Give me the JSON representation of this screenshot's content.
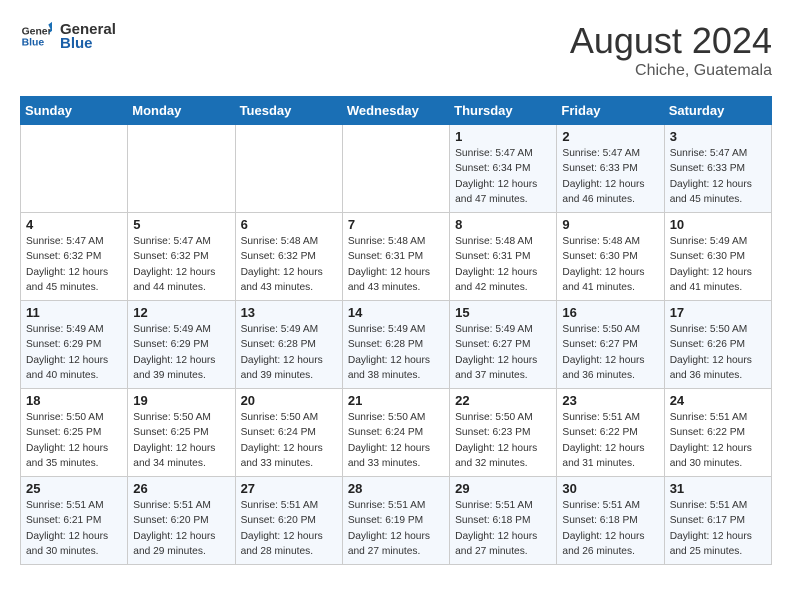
{
  "logo": {
    "line1": "General",
    "line2": "Blue"
  },
  "title": "August 2024",
  "subtitle": "Chiche, Guatemala",
  "weekdays": [
    "Sunday",
    "Monday",
    "Tuesday",
    "Wednesday",
    "Thursday",
    "Friday",
    "Saturday"
  ],
  "weeks": [
    [
      {
        "day": "",
        "info": ""
      },
      {
        "day": "",
        "info": ""
      },
      {
        "day": "",
        "info": ""
      },
      {
        "day": "",
        "info": ""
      },
      {
        "day": "1",
        "info": "Sunrise: 5:47 AM\nSunset: 6:34 PM\nDaylight: 12 hours\nand 47 minutes."
      },
      {
        "day": "2",
        "info": "Sunrise: 5:47 AM\nSunset: 6:33 PM\nDaylight: 12 hours\nand 46 minutes."
      },
      {
        "day": "3",
        "info": "Sunrise: 5:47 AM\nSunset: 6:33 PM\nDaylight: 12 hours\nand 45 minutes."
      }
    ],
    [
      {
        "day": "4",
        "info": "Sunrise: 5:47 AM\nSunset: 6:32 PM\nDaylight: 12 hours\nand 45 minutes."
      },
      {
        "day": "5",
        "info": "Sunrise: 5:47 AM\nSunset: 6:32 PM\nDaylight: 12 hours\nand 44 minutes."
      },
      {
        "day": "6",
        "info": "Sunrise: 5:48 AM\nSunset: 6:32 PM\nDaylight: 12 hours\nand 43 minutes."
      },
      {
        "day": "7",
        "info": "Sunrise: 5:48 AM\nSunset: 6:31 PM\nDaylight: 12 hours\nand 43 minutes."
      },
      {
        "day": "8",
        "info": "Sunrise: 5:48 AM\nSunset: 6:31 PM\nDaylight: 12 hours\nand 42 minutes."
      },
      {
        "day": "9",
        "info": "Sunrise: 5:48 AM\nSunset: 6:30 PM\nDaylight: 12 hours\nand 41 minutes."
      },
      {
        "day": "10",
        "info": "Sunrise: 5:49 AM\nSunset: 6:30 PM\nDaylight: 12 hours\nand 41 minutes."
      }
    ],
    [
      {
        "day": "11",
        "info": "Sunrise: 5:49 AM\nSunset: 6:29 PM\nDaylight: 12 hours\nand 40 minutes."
      },
      {
        "day": "12",
        "info": "Sunrise: 5:49 AM\nSunset: 6:29 PM\nDaylight: 12 hours\nand 39 minutes."
      },
      {
        "day": "13",
        "info": "Sunrise: 5:49 AM\nSunset: 6:28 PM\nDaylight: 12 hours\nand 39 minutes."
      },
      {
        "day": "14",
        "info": "Sunrise: 5:49 AM\nSunset: 6:28 PM\nDaylight: 12 hours\nand 38 minutes."
      },
      {
        "day": "15",
        "info": "Sunrise: 5:49 AM\nSunset: 6:27 PM\nDaylight: 12 hours\nand 37 minutes."
      },
      {
        "day": "16",
        "info": "Sunrise: 5:50 AM\nSunset: 6:27 PM\nDaylight: 12 hours\nand 36 minutes."
      },
      {
        "day": "17",
        "info": "Sunrise: 5:50 AM\nSunset: 6:26 PM\nDaylight: 12 hours\nand 36 minutes."
      }
    ],
    [
      {
        "day": "18",
        "info": "Sunrise: 5:50 AM\nSunset: 6:25 PM\nDaylight: 12 hours\nand 35 minutes."
      },
      {
        "day": "19",
        "info": "Sunrise: 5:50 AM\nSunset: 6:25 PM\nDaylight: 12 hours\nand 34 minutes."
      },
      {
        "day": "20",
        "info": "Sunrise: 5:50 AM\nSunset: 6:24 PM\nDaylight: 12 hours\nand 33 minutes."
      },
      {
        "day": "21",
        "info": "Sunrise: 5:50 AM\nSunset: 6:24 PM\nDaylight: 12 hours\nand 33 minutes."
      },
      {
        "day": "22",
        "info": "Sunrise: 5:50 AM\nSunset: 6:23 PM\nDaylight: 12 hours\nand 32 minutes."
      },
      {
        "day": "23",
        "info": "Sunrise: 5:51 AM\nSunset: 6:22 PM\nDaylight: 12 hours\nand 31 minutes."
      },
      {
        "day": "24",
        "info": "Sunrise: 5:51 AM\nSunset: 6:22 PM\nDaylight: 12 hours\nand 30 minutes."
      }
    ],
    [
      {
        "day": "25",
        "info": "Sunrise: 5:51 AM\nSunset: 6:21 PM\nDaylight: 12 hours\nand 30 minutes."
      },
      {
        "day": "26",
        "info": "Sunrise: 5:51 AM\nSunset: 6:20 PM\nDaylight: 12 hours\nand 29 minutes."
      },
      {
        "day": "27",
        "info": "Sunrise: 5:51 AM\nSunset: 6:20 PM\nDaylight: 12 hours\nand 28 minutes."
      },
      {
        "day": "28",
        "info": "Sunrise: 5:51 AM\nSunset: 6:19 PM\nDaylight: 12 hours\nand 27 minutes."
      },
      {
        "day": "29",
        "info": "Sunrise: 5:51 AM\nSunset: 6:18 PM\nDaylight: 12 hours\nand 27 minutes."
      },
      {
        "day": "30",
        "info": "Sunrise: 5:51 AM\nSunset: 6:18 PM\nDaylight: 12 hours\nand 26 minutes."
      },
      {
        "day": "31",
        "info": "Sunrise: 5:51 AM\nSunset: 6:17 PM\nDaylight: 12 hours\nand 25 minutes."
      }
    ]
  ]
}
